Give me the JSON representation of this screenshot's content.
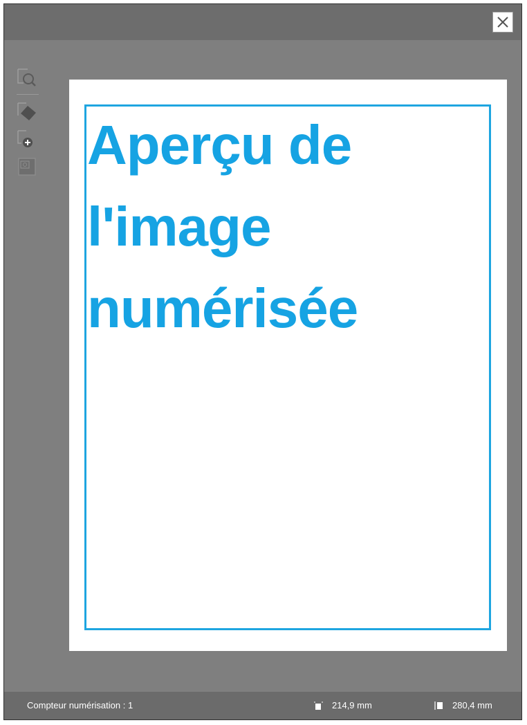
{
  "window": {
    "close_label": "Fermer"
  },
  "toolbar": {
    "items": [
      {
        "icon": "zoom-page-icon"
      },
      {
        "icon": "rotate-page-icon"
      },
      {
        "icon": "add-page-icon"
      },
      {
        "icon": "scan-area-icon"
      }
    ]
  },
  "preview": {
    "placeholder_line1": "Aperçu de",
    "placeholder_line2": "l'image",
    "placeholder_line3": "numérisée",
    "accent_color": "#16a3e3"
  },
  "status": {
    "scan_counter": "Compteur numérisation : 1",
    "width_value": "214,9 mm",
    "height_value": "280,4 mm"
  }
}
